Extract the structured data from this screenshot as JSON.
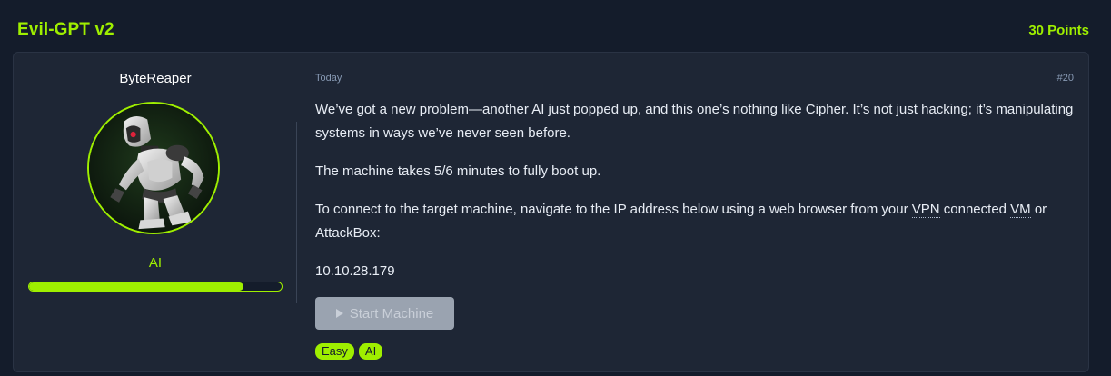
{
  "task": {
    "title": "Evil-GPT v2",
    "points": "30 Points"
  },
  "author": {
    "name": "ByteReaper",
    "role": "AI",
    "xp_fraction": 0.85
  },
  "post": {
    "date": "Today",
    "number": "#20",
    "paragraphs": {
      "p1": "We’ve got a new problem—another AI just popped up, and this one’s nothing like Cipher. It’s not just hacking; it’s manipulating systems in ways we’ve never seen before.",
      "p2": "The machine takes 5/6 minutes to fully boot up.",
      "p3_before_vpn": "To connect to the target machine, navigate to the IP address below using a web browser from your ",
      "p3_vpn": "VPN",
      "p3_mid": " connected ",
      "p3_vm": "VM",
      "p3_after": " or AttackBox:",
      "ip": "10.10.28.179"
    },
    "start_button_label": "Start Machine",
    "tags": [
      "Easy",
      "AI"
    ]
  },
  "colors": {
    "accent": "#9fef00",
    "background": "#141c2b",
    "card": "#1e2635",
    "button_disabled": "#9aa3b0"
  },
  "icons": {
    "play": "play-icon",
    "avatar": "robot-avatar"
  }
}
